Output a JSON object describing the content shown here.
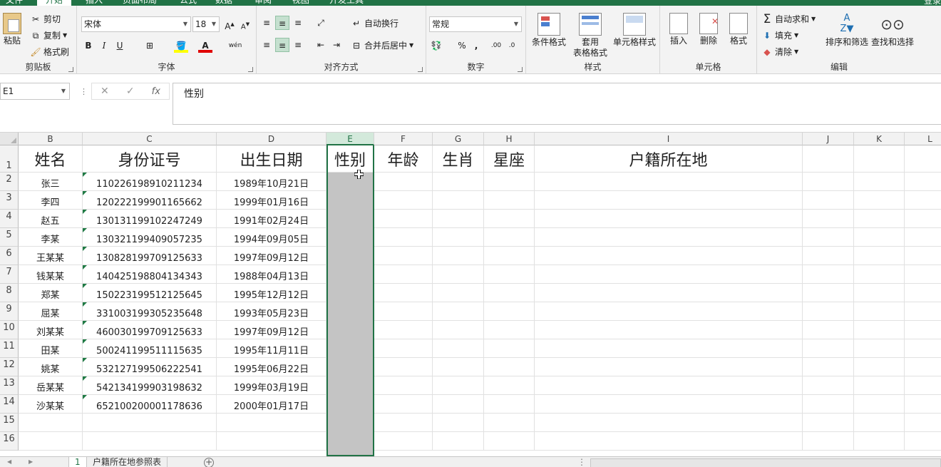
{
  "ribbon_tabs": [
    "文件",
    "开始",
    "插入",
    "页面布局",
    "公式",
    "数据",
    "审阅",
    "视图",
    "开发工具"
  ],
  "account_label": "登录",
  "clipboard": {
    "paste": "粘贴",
    "cut": "剪切",
    "copy": "复制",
    "format_painter": "格式刷",
    "label": "剪贴板"
  },
  "font": {
    "name": "宋体",
    "size": "18",
    "bold": "B",
    "italic": "I",
    "underline": "U",
    "label": "字体"
  },
  "alignment": {
    "wrap": "自动换行",
    "merge": "合并后居中",
    "label": "对齐方式"
  },
  "number": {
    "format": "常规",
    "label": "数字",
    "percent": "%",
    "comma": ","
  },
  "styles": {
    "conditional": "条件格式",
    "table_l1": "套用",
    "table_l2": "表格格式",
    "cell_styles": "单元格样式",
    "label": "样式"
  },
  "cells": {
    "insert": "插入",
    "delete": "删除",
    "format": "格式",
    "label": "单元格"
  },
  "editing": {
    "autosum": "自动求和",
    "fill": "填充",
    "clear": "清除",
    "sort": "排序和筛选",
    "find": "查找和选择",
    "label": "编辑"
  },
  "formula_bar": {
    "name_box": "E1",
    "fx": "fx",
    "content": "性别"
  },
  "columns": [
    "B",
    "C",
    "D",
    "E",
    "F",
    "G",
    "H",
    "I",
    "J",
    "K",
    "L"
  ],
  "rows": [
    "1",
    "2",
    "3",
    "4",
    "5",
    "6",
    "7",
    "8",
    "9",
    "10",
    "11",
    "12",
    "13",
    "14",
    "15",
    "16"
  ],
  "headers": [
    "姓名",
    "身份证号",
    "出生日期",
    "性别",
    "年龄",
    "生肖",
    "星座",
    "户籍所在地"
  ],
  "data_rows": [
    {
      "name": "张三",
      "id": "110226198910211234",
      "dob": "1989年10月21日"
    },
    {
      "name": "李四",
      "id": "120222199901165662",
      "dob": "1999年01月16日"
    },
    {
      "name": "赵五",
      "id": "130131199102247249",
      "dob": "1991年02月24日"
    },
    {
      "name": "李某",
      "id": "130321199409057235",
      "dob": "1994年09月05日"
    },
    {
      "name": "王某某",
      "id": "130828199709125633",
      "dob": "1997年09月12日"
    },
    {
      "name": "钱某某",
      "id": "140425198804134343",
      "dob": "1988年04月13日"
    },
    {
      "name": "郑某",
      "id": "150223199512125645",
      "dob": "1995年12月12日"
    },
    {
      "name": "屈某",
      "id": "331003199305235648",
      "dob": "1993年05月23日"
    },
    {
      "name": "刘某某",
      "id": "460030199709125633",
      "dob": "1997年09月12日"
    },
    {
      "name": "田某",
      "id": "500241199511115635",
      "dob": "1995年11月11日"
    },
    {
      "name": "姚某",
      "id": "532127199506222541",
      "dob": "1995年06月22日"
    },
    {
      "name": "岳某某",
      "id": "542134199903198632",
      "dob": "1999年03月19日"
    },
    {
      "name": "沙某某",
      "id": "652100200001178636",
      "dob": "2000年01月17日"
    }
  ],
  "sheet_tabs": [
    "1",
    "户籍所在地参照表"
  ],
  "colors": {
    "accent": "#217346",
    "selection_fill": "#c4c4c4"
  }
}
